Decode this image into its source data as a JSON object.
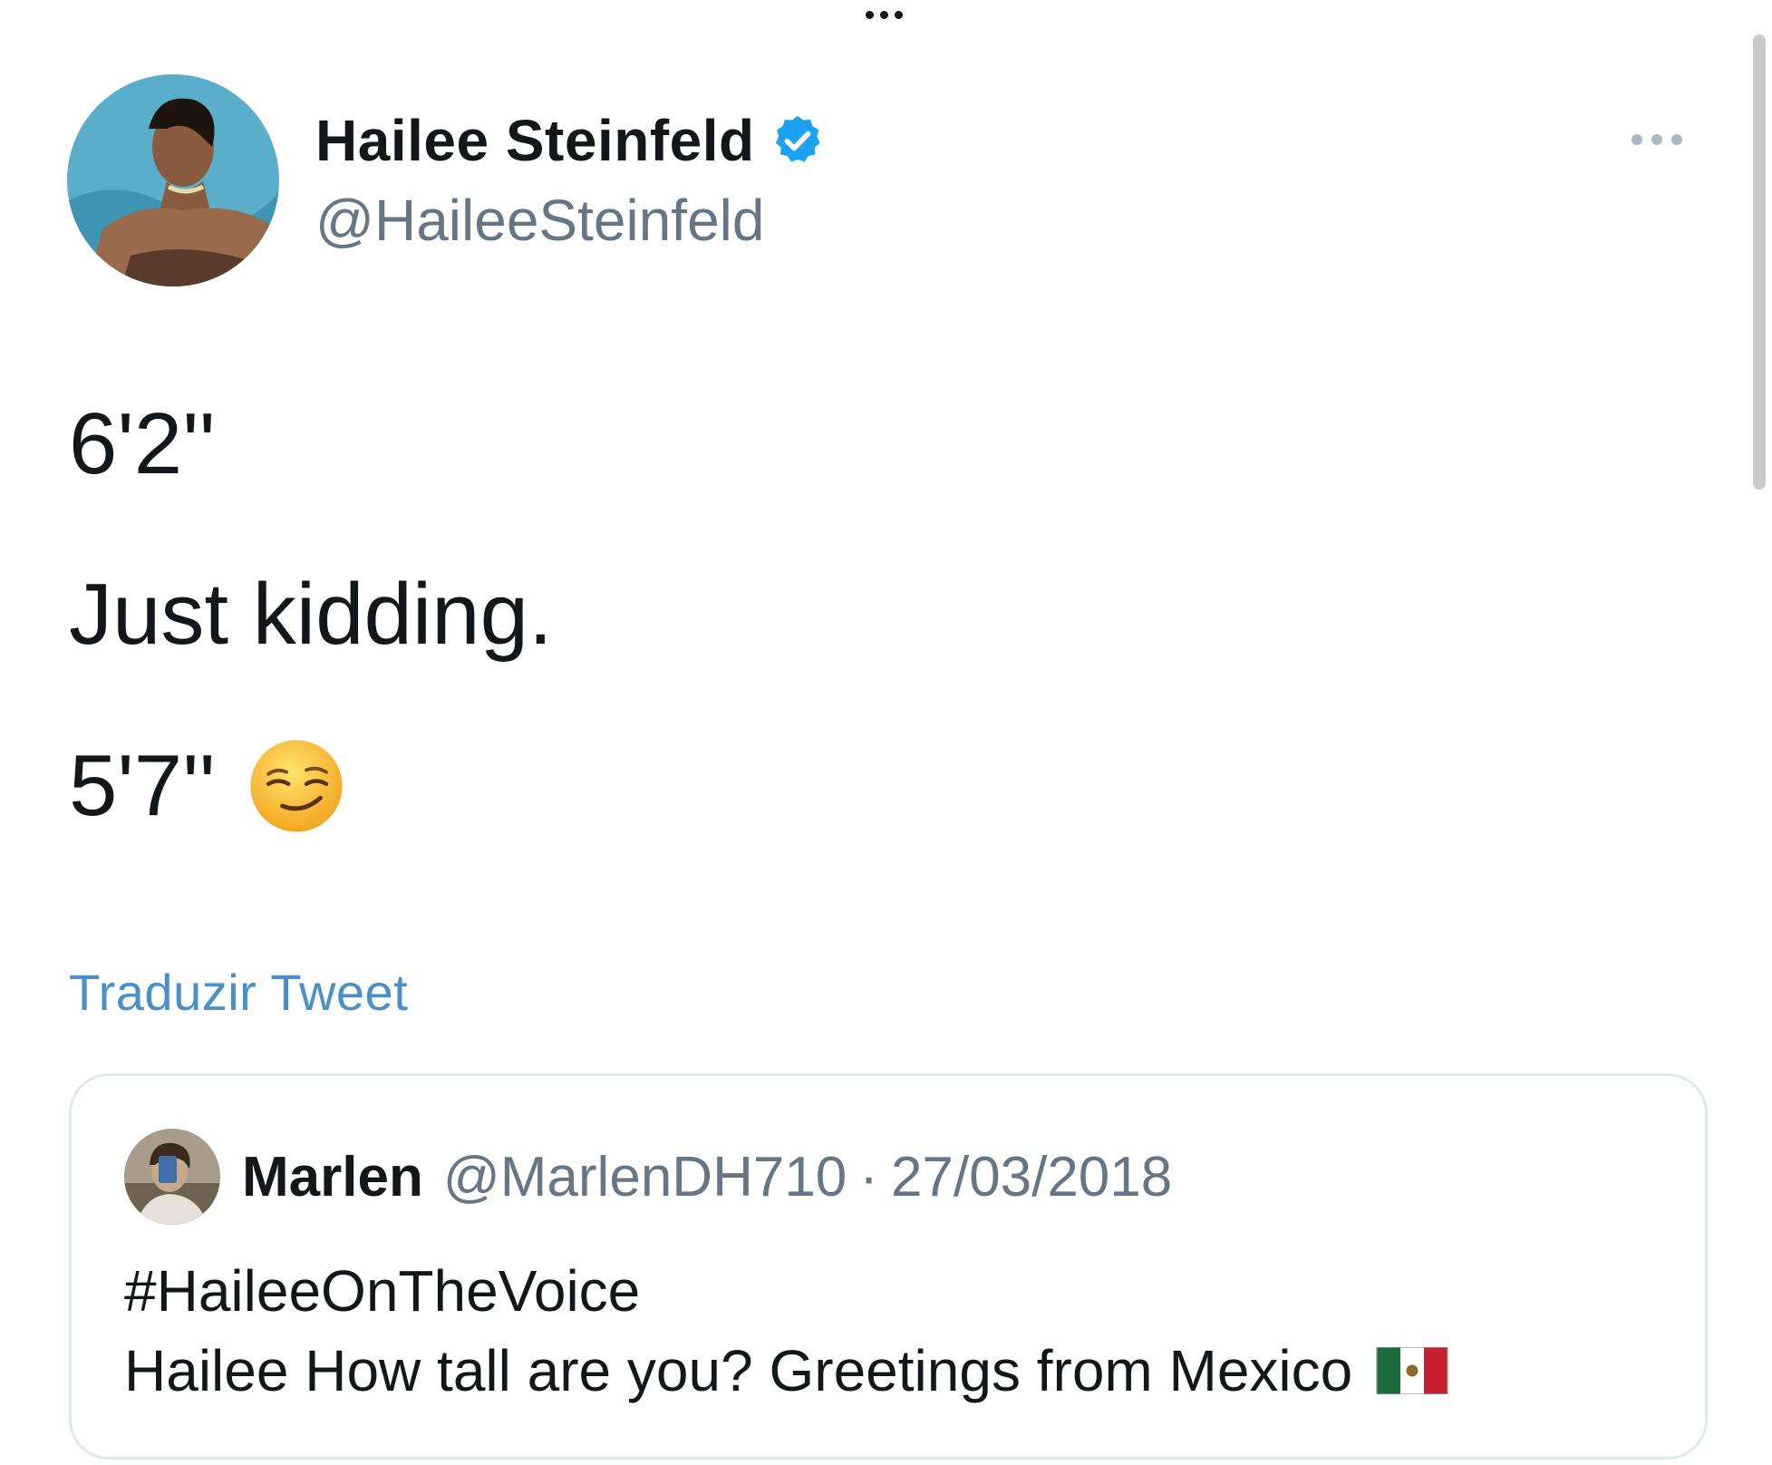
{
  "author": {
    "display_name": "Hailee Steinfeld",
    "handle": "@HaileeSteinfeld",
    "verified": true
  },
  "tweet": {
    "lines": [
      "6'2''",
      "Just kidding.",
      "5'7''"
    ],
    "emoji": "smirking-face-icon"
  },
  "translate_label": "Traduzir Tweet",
  "quoted_tweet": {
    "display_name": "Marlen",
    "handle": "@MarlenDH710",
    "separator": "·",
    "date": "27/03/2018",
    "hashtag": "#HaileeOnTheVoice",
    "text": "Hailee How tall are you? Greetings from Mexico",
    "emoji": "mexico-flag-icon"
  },
  "colors": {
    "link": "#4a90c8",
    "secondary_text": "#657786",
    "verified_badge": "#1da1f2"
  }
}
